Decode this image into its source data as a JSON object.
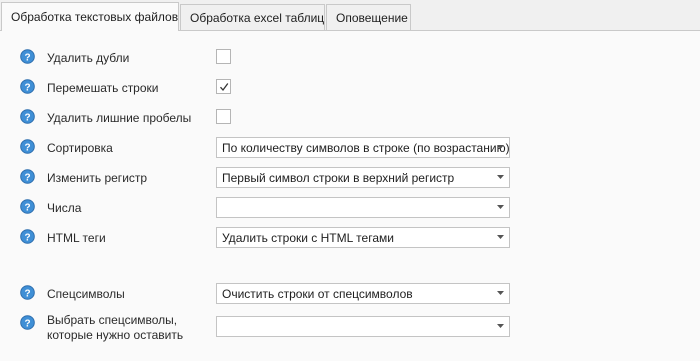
{
  "tabs": [
    {
      "label": "Обработка текстовых файлов",
      "active": true
    },
    {
      "label": "Обработка excel таблиц",
      "active": false
    },
    {
      "label": "Оповещение",
      "active": false
    }
  ],
  "options": {
    "remove_duplicates": {
      "label": "Удалить дубли",
      "checked": false
    },
    "shuffle_lines": {
      "label": "Перемешать строки",
      "checked": true
    },
    "remove_extra_spaces": {
      "label": "Удалить лишние пробелы",
      "checked": false
    },
    "sorting": {
      "label": "Сортировка",
      "value": "По количеству символов в строке (по возрастанию)"
    },
    "change_case": {
      "label": "Изменить регистр",
      "value": "Первый символ строки в верхний регистр"
    },
    "numbers": {
      "label": "Числа",
      "value": ""
    },
    "html_tags": {
      "label": "HTML теги",
      "value": "Удалить строки с HTML тегами"
    },
    "special_chars": {
      "label": "Спецсимволы",
      "value": "Очистить строки от спецсимволов"
    },
    "keep_special_chars": {
      "label_line1": "Выбрать спецсимволы,",
      "label_line2": "которые нужно оставить",
      "value": ""
    }
  },
  "colors": {
    "help_icon_fill": "#3f8fd6",
    "help_icon_border": "#2f6fae",
    "panel_bg": "#fafafa",
    "window_bg": "#f0f0f0"
  },
  "icons": {
    "help": "question-circle-icon",
    "dropdown": "chevron-down-icon",
    "check": "checkmark-icon"
  }
}
